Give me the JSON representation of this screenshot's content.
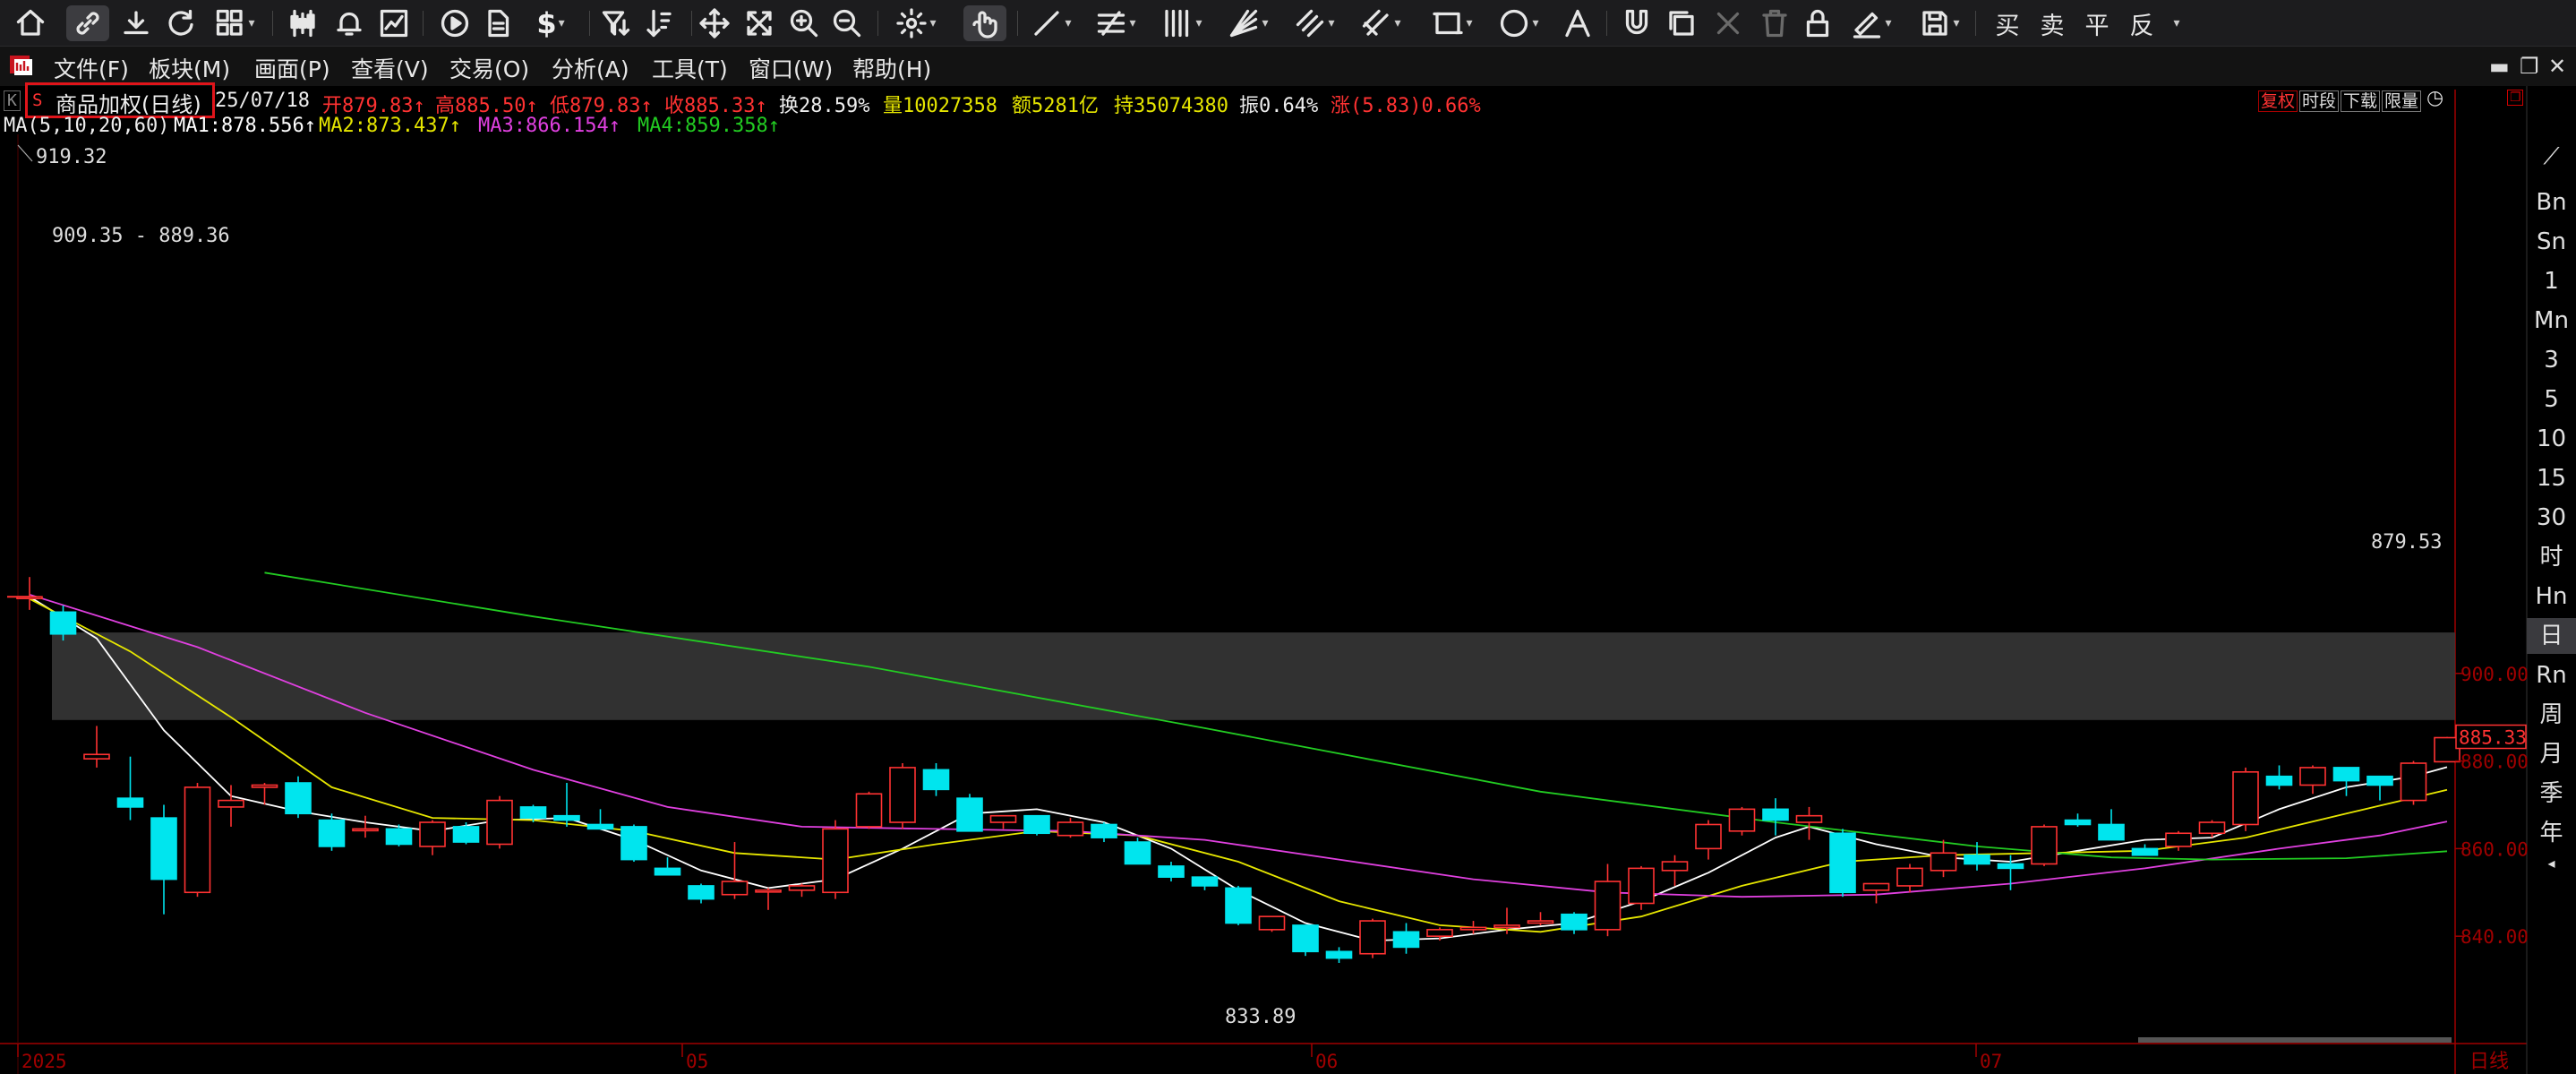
{
  "toolbar": {
    "right_labels": [
      "买",
      "卖",
      "平",
      "反"
    ]
  },
  "menu": {
    "items": [
      "文件(F)",
      "板块(M)",
      "画面(P)",
      "查看(V)",
      "交易(O)",
      "分析(A)",
      "工具(T)",
      "窗口(W)",
      "帮助(H)"
    ]
  },
  "header": {
    "k_mark": "K",
    "s_mark": "S",
    "title": "商品加权(日线)",
    "date": "25/07/18",
    "open": "开879.83↑",
    "high": "高885.50↑",
    "low": "低879.83↑",
    "close": "收885.33↑",
    "turnover": "换28.59%",
    "volume": "量10027358",
    "amount": "额5281亿",
    "position": "持35074380",
    "amplitude": "振0.64%",
    "change": "涨(5.83)0.66%"
  },
  "ma_line": {
    "label": "MA(5,10,20,60)",
    "ma1": "MA1:878.556↑",
    "ma2": "MA2:873.437↑",
    "ma3": "MA3:866.154↑",
    "ma4": "MA4:859.358↑"
  },
  "right_buttons": [
    "复权",
    "时段",
    "下载",
    "限量"
  ],
  "period_bar": [
    "Bn",
    "Sn",
    "1",
    "Mn",
    "3",
    "5",
    "10",
    "15",
    "30",
    "时",
    "Hn",
    "日",
    "Rn",
    "周",
    "月",
    "季",
    "年"
  ],
  "period_selected": "日",
  "price_axis": {
    "ticks": [
      "900.00",
      "880.00",
      "860.00",
      "840.00"
    ],
    "current_price": "885.33"
  },
  "date_axis": {
    "ticks": [
      "2025",
      "05",
      "06",
      "07"
    ],
    "bottom_label": "日线"
  },
  "annotations": {
    "peak": "919.32",
    "zone": "909.35 - 889.36",
    "low": "833.89",
    "last": "879.53"
  },
  "colors": {
    "up": "#ff3232",
    "down": "#00e5ee",
    "ma1": "#ffffff",
    "ma2": "#e6e600",
    "ma3": "#e040e0",
    "ma4": "#22cc22",
    "axis": "#a00000"
  },
  "chart_data": {
    "type": "candlestick",
    "ylim": [
      828,
      925
    ],
    "zone": [
      889.36,
      909.35
    ],
    "candles": [
      {
        "o": 917.5,
        "h": 922.0,
        "l": 914.5,
        "c": 917.5
      },
      {
        "o": 914.0,
        "h": 915.5,
        "l": 907.5,
        "c": 909.0
      },
      {
        "o": 880.5,
        "h": 888.0,
        "l": 878.5,
        "c": 881.5
      },
      {
        "o": 871.5,
        "h": 881.0,
        "l": 866.5,
        "c": 869.5
      },
      {
        "o": 867.0,
        "h": 870.0,
        "l": 845.0,
        "c": 853.0
      },
      {
        "o": 850.0,
        "h": 875.0,
        "l": 849.0,
        "c": 874.0
      },
      {
        "o": 869.5,
        "h": 874.5,
        "l": 865.0,
        "c": 871.0
      },
      {
        "o": 874.0,
        "h": 875.0,
        "l": 870.0,
        "c": 874.5
      },
      {
        "o": 875.0,
        "h": 876.5,
        "l": 867.0,
        "c": 868.0
      },
      {
        "o": 866.5,
        "h": 868.0,
        "l": 859.5,
        "c": 860.5
      },
      {
        "o": 864.5,
        "h": 867.5,
        "l": 862.5,
        "c": 864.5
      },
      {
        "o": 864.5,
        "h": 865.5,
        "l": 860.5,
        "c": 861.0
      },
      {
        "o": 860.5,
        "h": 866.5,
        "l": 858.5,
        "c": 866.0
      },
      {
        "o": 865.0,
        "h": 866.0,
        "l": 861.0,
        "c": 861.5
      },
      {
        "o": 861.0,
        "h": 872.0,
        "l": 860.0,
        "c": 871.0
      },
      {
        "o": 869.5,
        "h": 870.0,
        "l": 866.0,
        "c": 867.0
      },
      {
        "o": 867.5,
        "h": 875.0,
        "l": 865.0,
        "c": 866.5
      },
      {
        "o": 865.5,
        "h": 869.0,
        "l": 865.0,
        "c": 864.5
      },
      {
        "o": 865.0,
        "h": 865.5,
        "l": 857.0,
        "c": 857.5
      },
      {
        "o": 855.5,
        "h": 858.0,
        "l": 854.0,
        "c": 854.0
      },
      {
        "o": 851.5,
        "h": 852.0,
        "l": 847.5,
        "c": 848.5
      },
      {
        "o": 849.5,
        "h": 861.5,
        "l": 848.5,
        "c": 852.5
      },
      {
        "o": 850.5,
        "h": 851.0,
        "l": 846.0,
        "c": 850.5
      },
      {
        "o": 850.5,
        "h": 852.0,
        "l": 849.0,
        "c": 851.5
      },
      {
        "o": 850.0,
        "h": 866.5,
        "l": 848.5,
        "c": 864.5
      },
      {
        "o": 865.0,
        "h": 873.0,
        "l": 864.5,
        "c": 872.5
      },
      {
        "o": 866.0,
        "h": 879.5,
        "l": 864.5,
        "c": 878.5
      },
      {
        "o": 878.0,
        "h": 879.5,
        "l": 872.0,
        "c": 873.5
      },
      {
        "o": 871.5,
        "h": 872.5,
        "l": 864.0,
        "c": 864.0
      },
      {
        "o": 866.0,
        "h": 867.5,
        "l": 864.5,
        "c": 867.5
      },
      {
        "o": 867.5,
        "h": 867.5,
        "l": 863.0,
        "c": 863.5
      },
      {
        "o": 863.0,
        "h": 867.0,
        "l": 862.5,
        "c": 866.0
      },
      {
        "o": 865.5,
        "h": 866.0,
        "l": 861.5,
        "c": 862.5
      },
      {
        "o": 861.5,
        "h": 862.5,
        "l": 856.5,
        "c": 856.5
      },
      {
        "o": 856.0,
        "h": 857.0,
        "l": 852.5,
        "c": 853.5
      },
      {
        "o": 853.5,
        "h": 853.5,
        "l": 850.5,
        "c": 851.5
      },
      {
        "o": 851.0,
        "h": 851.5,
        "l": 842.5,
        "c": 843.0
      },
      {
        "o": 841.5,
        "h": 844.5,
        "l": 841.0,
        "c": 844.5
      },
      {
        "o": 842.5,
        "h": 842.5,
        "l": 835.5,
        "c": 836.5
      },
      {
        "o": 836.5,
        "h": 837.5,
        "l": 833.9,
        "c": 835.0
      },
      {
        "o": 836.0,
        "h": 844.0,
        "l": 835.0,
        "c": 843.5
      },
      {
        "o": 841.0,
        "h": 843.0,
        "l": 836.0,
        "c": 837.5
      },
      {
        "o": 840.0,
        "h": 842.0,
        "l": 839.0,
        "c": 841.5
      },
      {
        "o": 841.5,
        "h": 843.5,
        "l": 840.5,
        "c": 842.0
      },
      {
        "o": 842.0,
        "h": 846.5,
        "l": 840.5,
        "c": 842.5
      },
      {
        "o": 843.0,
        "h": 845.5,
        "l": 842.5,
        "c": 843.5
      },
      {
        "o": 845.0,
        "h": 845.5,
        "l": 840.5,
        "c": 841.5
      },
      {
        "o": 841.5,
        "h": 856.5,
        "l": 840.0,
        "c": 852.5
      },
      {
        "o": 847.5,
        "h": 856.0,
        "l": 846.0,
        "c": 855.5
      },
      {
        "o": 855.0,
        "h": 858.5,
        "l": 851.5,
        "c": 857.0
      },
      {
        "o": 860.0,
        "h": 866.5,
        "l": 857.5,
        "c": 865.5
      },
      {
        "o": 864.0,
        "h": 869.5,
        "l": 863.0,
        "c": 869.0
      },
      {
        "o": 869.0,
        "h": 871.5,
        "l": 863.0,
        "c": 866.5
      },
      {
        "o": 866.0,
        "h": 869.5,
        "l": 862.0,
        "c": 867.5
      },
      {
        "o": 863.5,
        "h": 864.5,
        "l": 849.0,
        "c": 850.0
      },
      {
        "o": 850.5,
        "h": 852.0,
        "l": 847.5,
        "c": 852.0
      },
      {
        "o": 851.5,
        "h": 856.5,
        "l": 850.0,
        "c": 855.5
      },
      {
        "o": 855.0,
        "h": 862.0,
        "l": 853.5,
        "c": 859.0
      },
      {
        "o": 858.5,
        "h": 861.5,
        "l": 855.0,
        "c": 856.5
      },
      {
        "o": 856.5,
        "h": 858.5,
        "l": 850.5,
        "c": 855.5
      },
      {
        "o": 856.5,
        "h": 865.5,
        "l": 856.0,
        "c": 865.0
      },
      {
        "o": 866.5,
        "h": 868.0,
        "l": 865.0,
        "c": 865.5
      },
      {
        "o": 865.5,
        "h": 869.0,
        "l": 862.0,
        "c": 862.0
      },
      {
        "o": 860.0,
        "h": 861.0,
        "l": 858.5,
        "c": 858.5
      },
      {
        "o": 860.5,
        "h": 864.0,
        "l": 859.5,
        "c": 863.5
      },
      {
        "o": 863.5,
        "h": 866.5,
        "l": 862.5,
        "c": 866.0
      },
      {
        "o": 865.5,
        "h": 878.5,
        "l": 864.0,
        "c": 877.5
      },
      {
        "o": 876.5,
        "h": 879.0,
        "l": 873.5,
        "c": 874.5
      },
      {
        "o": 874.5,
        "h": 879.0,
        "l": 872.5,
        "c": 878.5
      },
      {
        "o": 878.5,
        "h": 878.5,
        "l": 872.0,
        "c": 875.5
      },
      {
        "o": 876.5,
        "h": 876.5,
        "l": 871.0,
        "c": 874.5
      },
      {
        "o": 871.0,
        "h": 880.0,
        "l": 870.0,
        "c": 879.5
      },
      {
        "o": 879.83,
        "h": 885.5,
        "l": 879.83,
        "c": 885.33
      }
    ],
    "ma_series": [
      {
        "name": "MA1",
        "values": [
          [
            0,
            917.5
          ],
          [
            2,
            908.0
          ],
          [
            4,
            887.0
          ],
          [
            6,
            872.0
          ],
          [
            8,
            868.5
          ],
          [
            10,
            866.0
          ],
          [
            12,
            864.0
          ],
          [
            14,
            866.5
          ],
          [
            16,
            867.0
          ],
          [
            18,
            862.0
          ],
          [
            20,
            855.0
          ],
          [
            22,
            851.0
          ],
          [
            24,
            853.0
          ],
          [
            26,
            860.0
          ],
          [
            28,
            868.0
          ],
          [
            30,
            869.0
          ],
          [
            32,
            866.0
          ],
          [
            34,
            860.0
          ],
          [
            36,
            850.5
          ],
          [
            38,
            843.0
          ],
          [
            40,
            839.0
          ],
          [
            42,
            839.5
          ],
          [
            44,
            841.5
          ],
          [
            46,
            843.0
          ],
          [
            48,
            848.0
          ],
          [
            50,
            854.5
          ],
          [
            52,
            862.5
          ],
          [
            53,
            865.0
          ],
          [
            55,
            861.0
          ],
          [
            57,
            858.0
          ],
          [
            59,
            857.0
          ],
          [
            61,
            859.5
          ],
          [
            63,
            862.0
          ],
          [
            65,
            862.5
          ],
          [
            67,
            869.0
          ],
          [
            69,
            874.0
          ],
          [
            71,
            876.5
          ],
          [
            72,
            878.6
          ]
        ]
      },
      {
        "name": "MA2",
        "values": [
          [
            0,
            917.0
          ],
          [
            3,
            905.0
          ],
          [
            6,
            890.0
          ],
          [
            9,
            874.0
          ],
          [
            12,
            867.0
          ],
          [
            15,
            866.5
          ],
          [
            18,
            864.0
          ],
          [
            21,
            859.0
          ],
          [
            24,
            857.5
          ],
          [
            27,
            861.0
          ],
          [
            30,
            864.0
          ],
          [
            33,
            863.0
          ],
          [
            36,
            857.0
          ],
          [
            39,
            848.0
          ],
          [
            42,
            842.5
          ],
          [
            45,
            841.0
          ],
          [
            48,
            844.5
          ],
          [
            51,
            851.5
          ],
          [
            54,
            857.0
          ],
          [
            57,
            858.5
          ],
          [
            60,
            859.0
          ],
          [
            63,
            859.5
          ],
          [
            66,
            862.5
          ],
          [
            69,
            868.0
          ],
          [
            72,
            873.4
          ]
        ]
      },
      {
        "name": "MA3",
        "values": [
          [
            0,
            918.0
          ],
          [
            5,
            906.0
          ],
          [
            10,
            891.0
          ],
          [
            15,
            878.0
          ],
          [
            19,
            869.5
          ],
          [
            23,
            865.0
          ],
          [
            27,
            864.5
          ],
          [
            31,
            864.0
          ],
          [
            35,
            862.0
          ],
          [
            39,
            857.5
          ],
          [
            43,
            853.0
          ],
          [
            47,
            850.0
          ],
          [
            51,
            849.0
          ],
          [
            55,
            849.5
          ],
          [
            59,
            852.0
          ],
          [
            63,
            855.5
          ],
          [
            67,
            860.0
          ],
          [
            70,
            863.0
          ],
          [
            72,
            866.2
          ]
        ]
      },
      {
        "name": "MA4",
        "values": [
          [
            7,
            923.0
          ],
          [
            15,
            913.0
          ],
          [
            25,
            901.5
          ],
          [
            35,
            887.5
          ],
          [
            45,
            873.0
          ],
          [
            52,
            866.0
          ],
          [
            58,
            860.5
          ],
          [
            62,
            858.0
          ],
          [
            65,
            857.5
          ],
          [
            69,
            857.8
          ],
          [
            72,
            859.4
          ]
        ]
      }
    ]
  }
}
